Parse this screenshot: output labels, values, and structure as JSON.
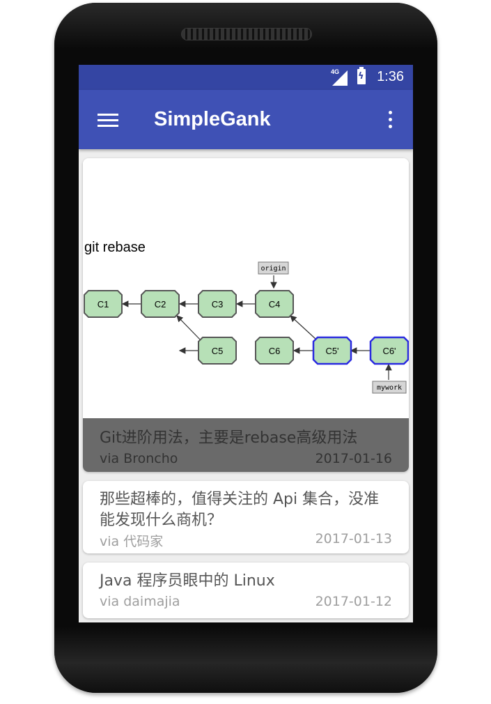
{
  "status_bar": {
    "network": "4G",
    "time": "1:36"
  },
  "app_bar": {
    "title": "SimpleGank"
  },
  "icons": {
    "menu": "hamburger-menu-icon",
    "more": "more-vert-icon",
    "signal": "signal-icon",
    "battery": "battery-charging-icon"
  },
  "colors": {
    "status_bar": "#3445a3",
    "app_bar": "#3f51b5",
    "overlay": "#6a6a6a",
    "node_fill": "#b7e0b7",
    "node_border_blue": "#2a2ae0"
  },
  "feed": [
    {
      "title": "Git进阶用法，主要是rebase高级用法",
      "via": "via Broncho",
      "date": "2017-01-16",
      "image": {
        "heading": "git rebase",
        "nodes": [
          "C1",
          "C2",
          "C3",
          "C4",
          "C5",
          "C6",
          "C5'",
          "C6'"
        ],
        "tags": [
          "origin",
          "mywork"
        ]
      }
    },
    {
      "title": "那些超棒的，值得关注的 Api 集合，没准能发现什么商机？",
      "via": "via 代码家",
      "date": "2017-01-13"
    },
    {
      "title": "Java 程序员眼中的 Linux",
      "via": "via daimajia",
      "date": "2017-01-12"
    }
  ]
}
